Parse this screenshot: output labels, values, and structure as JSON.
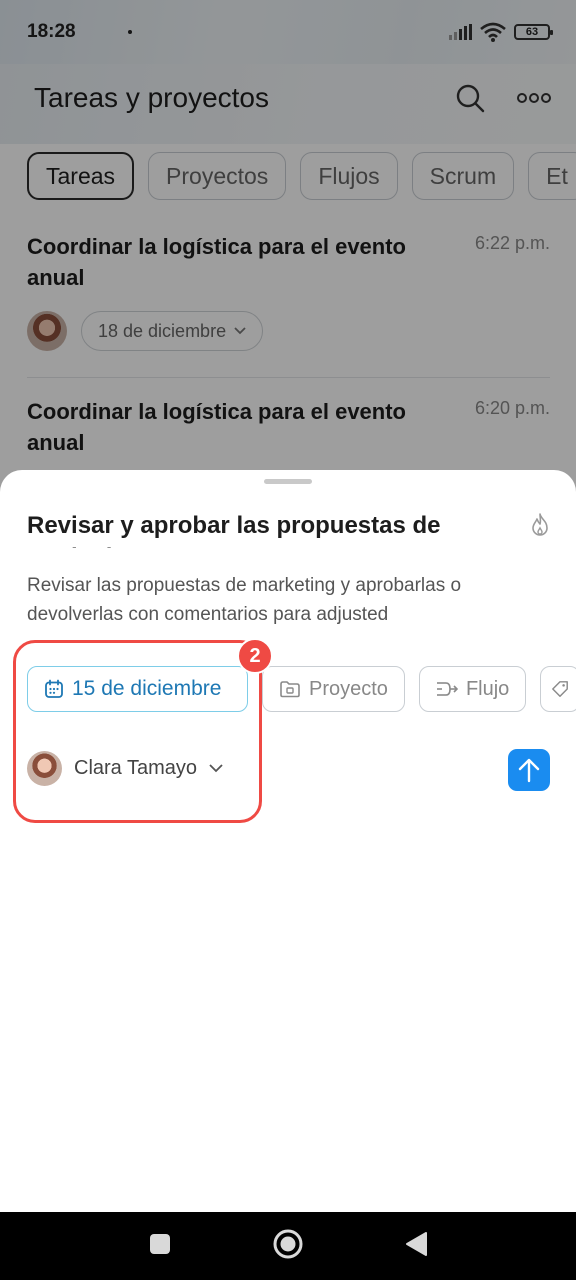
{
  "status_bar": {
    "time": "18:28",
    "battery": "63"
  },
  "header": {
    "title": "Tareas y proyectos",
    "search_icon": "search-icon",
    "more_icon": "more-horizontal-icon"
  },
  "tabs": [
    {
      "label": "Tareas",
      "active": true
    },
    {
      "label": "Proyectos",
      "active": false
    },
    {
      "label": "Flujos",
      "active": false
    },
    {
      "label": "Scrum",
      "active": false
    },
    {
      "label": "Et",
      "active": false
    }
  ],
  "tasks": [
    {
      "title": "Coordinar la logística para el evento anual",
      "time": "6:22 p.m.",
      "deadline": "18 de diciembre"
    },
    {
      "title": "Coordinar la logística para el evento anual",
      "time": "6:20 p.m."
    }
  ],
  "sheet": {
    "title": "Revisar y aprobar las propuestas de marketing",
    "description": "Revisar las propuestas de marketing y aprobarlas o devolverlas con comentarios para adjusted",
    "chips": {
      "date": "15 de diciembre",
      "project": "Proyecto",
      "flow": "Flujo"
    },
    "responsible": "Clara Tamayo",
    "highlight_badge": "2"
  },
  "colors": {
    "accent": "#1a8cf0",
    "highlight": "#ef4a44",
    "date_chip_text": "#1e78b4"
  }
}
